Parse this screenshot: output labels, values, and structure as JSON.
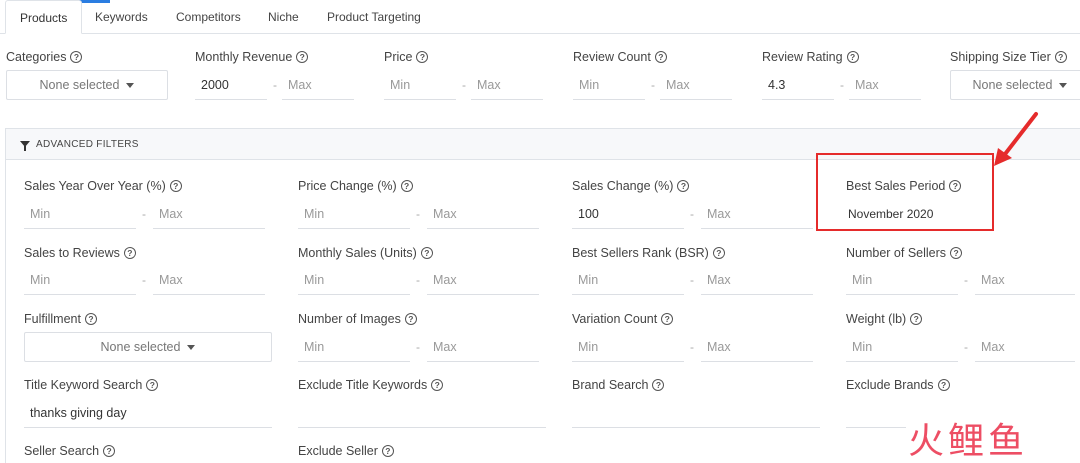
{
  "tabs": [
    {
      "label": "Products",
      "active": true
    },
    {
      "label": "Keywords",
      "active": false
    },
    {
      "label": "Competitors",
      "active": false
    },
    {
      "label": "Niche",
      "active": false
    },
    {
      "label": "Product Targeting",
      "active": false
    }
  ],
  "accent_color": "#2a7de1",
  "highlight_color": "#e52b2b",
  "top_filters": {
    "categories": {
      "label": "Categories",
      "value": "None selected"
    },
    "monthly_revenue": {
      "label": "Monthly Revenue",
      "min": "2000",
      "max": "Max"
    },
    "price": {
      "label": "Price",
      "min": "Min",
      "max": "Max"
    },
    "review_count": {
      "label": "Review Count",
      "min": "Min",
      "max": "Max"
    },
    "review_rating": {
      "label": "Review Rating",
      "min": "4.3",
      "max": "Max"
    },
    "shipping_size_tier": {
      "label": "Shipping Size Tier",
      "value": "None selected"
    }
  },
  "advanced": {
    "header": "ADVANCED FILTERS",
    "sales_yoy": {
      "label": "Sales Year Over Year (%)",
      "min": "Min",
      "max": "Max"
    },
    "price_change": {
      "label": "Price Change (%)",
      "min": "Min",
      "max": "Max"
    },
    "sales_change": {
      "label": "Sales Change (%)",
      "min": "100",
      "max": "Max"
    },
    "best_sales_period": {
      "label": "Best Sales Period",
      "value": "November 2020"
    },
    "sales_to_reviews": {
      "label": "Sales to Reviews",
      "min": "Min",
      "max": "Max"
    },
    "monthly_sales": {
      "label": "Monthly Sales (Units)",
      "min": "Min",
      "max": "Max"
    },
    "bsr": {
      "label": "Best Sellers Rank (BSR)",
      "min": "Min",
      "max": "Max"
    },
    "num_sellers": {
      "label": "Number of Sellers",
      "min": "Min",
      "max": "Max"
    },
    "fulfillment": {
      "label": "Fulfillment",
      "value": "None selected"
    },
    "num_images": {
      "label": "Number of Images",
      "min": "Min",
      "max": "Max"
    },
    "variation_count": {
      "label": "Variation Count",
      "min": "Min",
      "max": "Max"
    },
    "weight": {
      "label": "Weight (lb)",
      "min": "Min",
      "max": "Max"
    },
    "title_keyword": {
      "label": "Title Keyword Search",
      "value": "thanks giving day"
    },
    "exclude_title": {
      "label": "Exclude Title Keywords",
      "value": ""
    },
    "brand_search": {
      "label": "Brand Search",
      "value": ""
    },
    "exclude_brands": {
      "label": "Exclude Brands",
      "value": ""
    },
    "seller_search": {
      "label": "Seller Search"
    },
    "exclude_seller": {
      "label": "Exclude Seller"
    }
  },
  "help_glyph": "?",
  "range_separator": "-",
  "watermark": "火鲤鱼"
}
